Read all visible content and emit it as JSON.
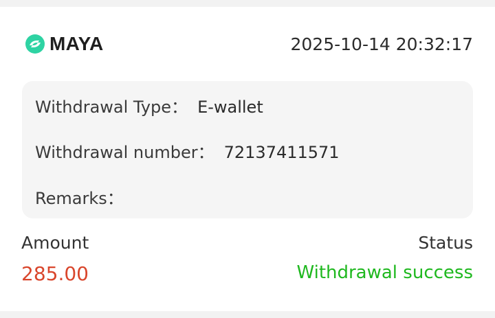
{
  "record": {
    "brand": "MAYA",
    "brand_icon": "maya-logo-icon",
    "brand_color": "#2ed3a3",
    "timestamp": "2025-10-14 20:32:17",
    "details": {
      "type_label": "Withdrawal Type：",
      "type_value": "E-wallet",
      "number_label": "Withdrawal number：",
      "number_value": "72137411571",
      "remarks_label": "Remarks：",
      "remarks_value": ""
    },
    "amount_label": "Amount",
    "amount_value": "285.00",
    "amount_color": "#d9462c",
    "status_label": "Status",
    "status_value": "Withdrawal success",
    "status_color": "#1fb81f"
  }
}
